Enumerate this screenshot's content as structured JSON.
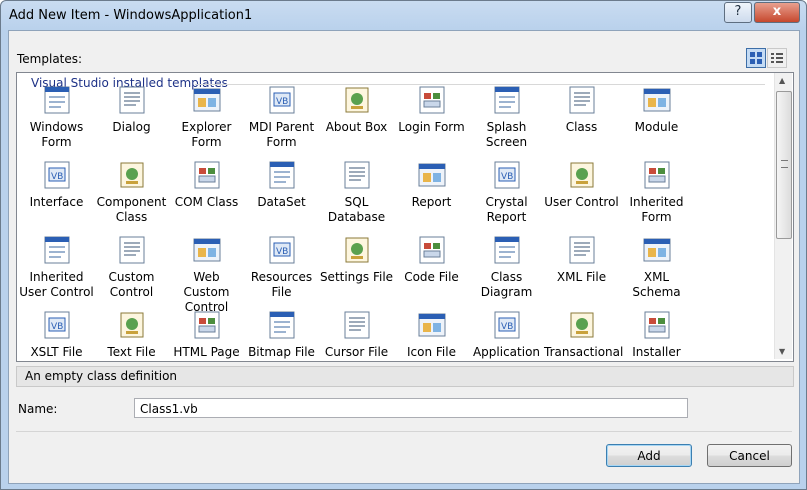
{
  "window": {
    "title": "Add New Item - WindowsApplication1",
    "help_label": "?",
    "close_label": "x"
  },
  "templates_label": "Templates:",
  "group_header": "Visual Studio installed templates",
  "items": [
    {
      "label": "Windows Form",
      "icon": "windows-form-icon"
    },
    {
      "label": "Dialog",
      "icon": "dialog-icon"
    },
    {
      "label": "Explorer Form",
      "icon": "explorer-form-icon"
    },
    {
      "label": "MDI Parent Form",
      "icon": "mdi-parent-form-icon"
    },
    {
      "label": "About Box",
      "icon": "about-box-icon"
    },
    {
      "label": "Login Form",
      "icon": "login-form-icon"
    },
    {
      "label": "Splash Screen",
      "icon": "splash-screen-icon"
    },
    {
      "label": "Class",
      "icon": "class-icon"
    },
    {
      "label": "Module",
      "icon": "module-icon"
    },
    {
      "label": "Interface",
      "icon": "interface-icon"
    },
    {
      "label": "Component Class",
      "icon": "component-class-icon"
    },
    {
      "label": "COM Class",
      "icon": "com-class-icon"
    },
    {
      "label": "DataSet",
      "icon": "dataset-icon"
    },
    {
      "label": "SQL Database",
      "icon": "sql-database-icon"
    },
    {
      "label": "Report",
      "icon": "report-icon"
    },
    {
      "label": "Crystal Report",
      "icon": "crystal-report-icon"
    },
    {
      "label": "User Control",
      "icon": "user-control-icon"
    },
    {
      "label": "Inherited Form",
      "icon": "inherited-form-icon"
    },
    {
      "label": "Inherited User Control",
      "icon": "inherited-user-control-icon"
    },
    {
      "label": "Custom Control",
      "icon": "custom-control-icon"
    },
    {
      "label": "Web Custom Control",
      "icon": "web-custom-control-icon"
    },
    {
      "label": "Resources File",
      "icon": "resources-file-icon"
    },
    {
      "label": "Settings File",
      "icon": "settings-file-icon"
    },
    {
      "label": "Code File",
      "icon": "code-file-icon"
    },
    {
      "label": "Class Diagram",
      "icon": "class-diagram-icon"
    },
    {
      "label": "XML File",
      "icon": "xml-file-icon"
    },
    {
      "label": "XML Schema",
      "icon": "xml-schema-icon"
    },
    {
      "label": "XSLT File",
      "icon": "xslt-file-icon"
    },
    {
      "label": "Text File",
      "icon": "text-file-icon"
    },
    {
      "label": "HTML Page",
      "icon": "html-page-icon"
    },
    {
      "label": "Bitmap File",
      "icon": "bitmap-file-icon"
    },
    {
      "label": "Cursor File",
      "icon": "cursor-file-icon"
    },
    {
      "label": "Icon File",
      "icon": "icon-file-icon"
    },
    {
      "label": "Application Configuration File",
      "icon": "app-config-icon"
    },
    {
      "label": "Transactional Component",
      "icon": "transactional-component-icon"
    },
    {
      "label": "Installer Class",
      "icon": "installer-class-icon"
    }
  ],
  "description": "An empty class definition",
  "name_label": "Name:",
  "name_value": "Class1.vb",
  "add_label": "Add",
  "cancel_label": "Cancel",
  "colors": {
    "accent": "#1e3287",
    "vb_blue": "#2b5fb4",
    "window_frame": "#b9d1ec"
  }
}
